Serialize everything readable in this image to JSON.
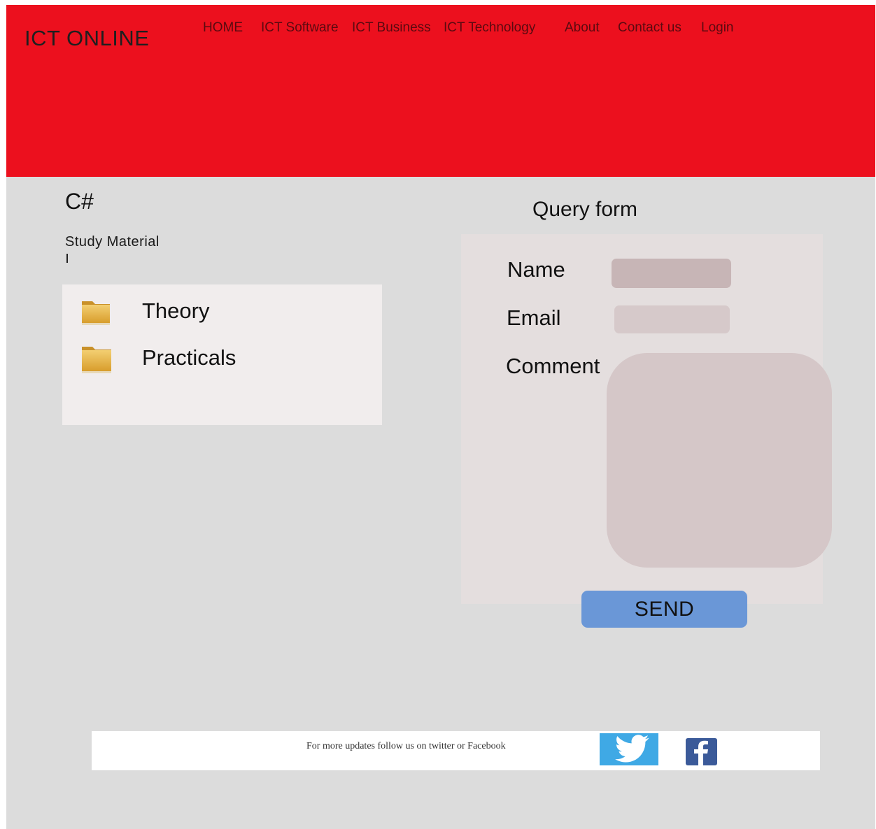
{
  "header": {
    "brand": "ICT ONLINE",
    "nav": [
      {
        "label": "HOME"
      },
      {
        "label": "ICT Software"
      },
      {
        "label": "ICT Business"
      },
      {
        "label": "ICT Technology"
      },
      {
        "label": "About"
      },
      {
        "label": "Contact us"
      },
      {
        "label": "Login"
      }
    ]
  },
  "content": {
    "title": "C#",
    "subtitle": "Study Material",
    "materials": [
      {
        "label": "Theory",
        "icon": "folder-icon"
      },
      {
        "label": "Practicals",
        "icon": "folder-icon"
      }
    ]
  },
  "query_form": {
    "title": "Query form",
    "name_label": "Name",
    "email_label": "Email",
    "comment_label": "Comment",
    "send_label": "SEND"
  },
  "footer": {
    "text": "For more updates follow us on twitter or Facebook",
    "social": [
      "twitter-icon",
      "facebook-icon"
    ]
  },
  "colors": {
    "header_bg": "#ec101e",
    "page_bg": "#dcdcdc",
    "send_button": "#6a97d7",
    "twitter": "#3fa9e5",
    "facebook": "#3b5a99"
  }
}
